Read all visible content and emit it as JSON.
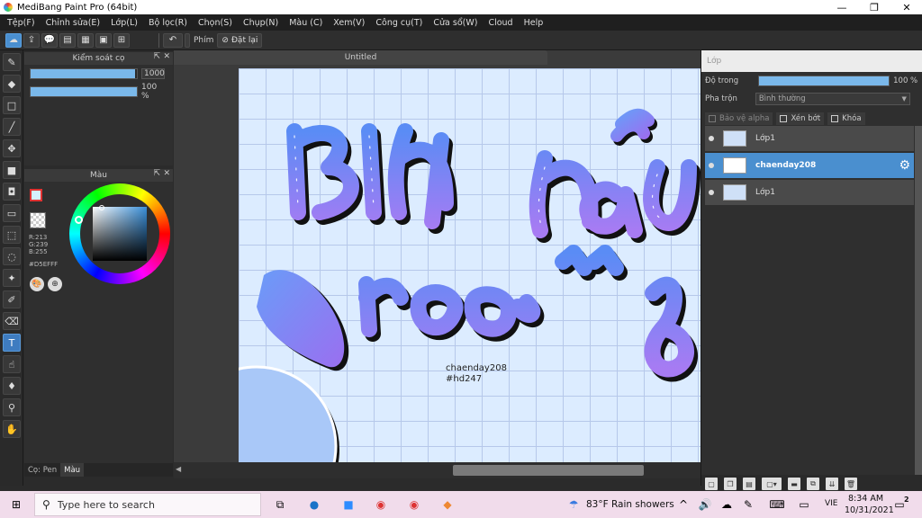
{
  "window": {
    "title": "MediBang Paint Pro (64bit)",
    "minimize": "—",
    "maximize": "❐",
    "close": "✕"
  },
  "menu": [
    "Tệp(F)",
    "Chỉnh sửa(E)",
    "Lớp(L)",
    "Bộ lọc(R)",
    "Chọn(S)",
    "Chụp(N)",
    "Màu (C)",
    "Xem(V)",
    "Công cụ(T)",
    "Cửa sổ(W)",
    "Cloud",
    "Help"
  ],
  "toolbar": {
    "phim_label": "Phím",
    "reset_label": "Đặt lại"
  },
  "brush_panel": {
    "title": "Kiểm soát cọ",
    "size_value": "1000",
    "opacity_value": "100 %",
    "size_fraction": 0.98,
    "opacity_fraction": 1.0
  },
  "color_panel": {
    "title": "Màu",
    "r": "R:213",
    "g": "G:239",
    "b": "B:255",
    "hex": "#D5EFFF",
    "foreground_color": "#D5EFFF",
    "accent_color": "#E03232"
  },
  "panel_tabs": [
    "Cọ: Pen",
    "Màu"
  ],
  "document": {
    "tab_title": "Untitled",
    "canvas_text_1": "chaenday208",
    "canvas_text_2": "#hd247"
  },
  "layer_panel": {
    "title": "Lớp",
    "opacity_label": "Độ trong",
    "opacity_value": "100 %",
    "opacity_fraction": 1.0,
    "blend_label": "Pha trộn",
    "blend_value": "Bình thường",
    "protect_alpha": "Bảo vệ alpha",
    "clipping": "Xén bớt",
    "lock": "Khóa",
    "layers": [
      {
        "name": "Lớp1",
        "selected": false
      },
      {
        "name": "chaenday208",
        "selected": true
      },
      {
        "name": "Lớp1",
        "selected": false
      }
    ]
  },
  "taskbar": {
    "search_placeholder": "Type here to search",
    "weather": "83°F  Rain showers",
    "language": "VIE",
    "time": "8:34 AM",
    "date": "10/31/2021",
    "notifications": "2"
  },
  "icons": {
    "tools": [
      "brush-icon",
      "eraser-icon",
      "rectangle-icon",
      "line-icon",
      "move-icon",
      "fill-rect-icon",
      "bucket-icon",
      "gradient-icon",
      "select-rect-icon",
      "lasso-icon",
      "magic-wand-icon",
      "select-pen-icon",
      "select-eraser-icon",
      "text-icon",
      "blur-icon",
      "smudge-icon",
      "eyedropper-icon",
      "hand-icon"
    ]
  }
}
